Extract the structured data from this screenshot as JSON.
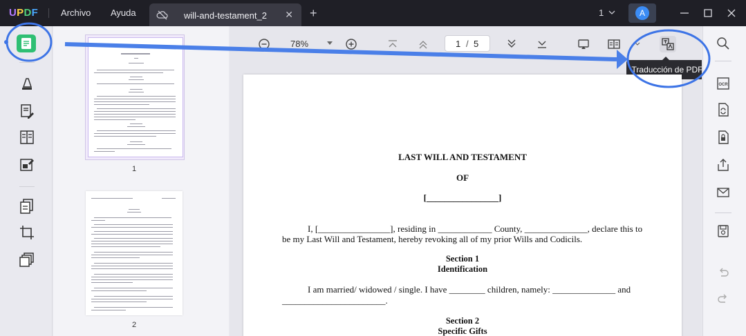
{
  "app": {
    "logo": {
      "l1": "U",
      "l2": "P",
      "l3": "D",
      "l4": "F"
    },
    "menu": {
      "file": "Archivo",
      "help": "Ayuda"
    },
    "tab": {
      "title": "will-and-testament_2",
      "close": "✕"
    },
    "new_tab": "+",
    "window_count": "1",
    "avatar_initial": "A"
  },
  "toolbar": {
    "zoom": "78%",
    "page_current": "1",
    "page_separator": "/",
    "page_total": "5",
    "tooltip": "Traducción de PDF"
  },
  "thumbnails": {
    "items": [
      {
        "label": "1"
      },
      {
        "label": "2"
      }
    ]
  },
  "document": {
    "title": "LAST WILL AND TESTAMENT",
    "of": "OF",
    "name_blank": "[________________]",
    "para1_line1": "I, [________________], residing in ____________ County, ______________, declare this to",
    "para1_line2": "be my Last Will and Testament, hereby revoking all of my prior Wills and Codicils.",
    "section1_title": "Section 1",
    "section1_sub": "Identification",
    "para2_line1": "I am married/ widowed / single.  I have ________ children, namely:  ______________ and",
    "para2_line2": "_______________________.",
    "section2_title": "Section 2",
    "section2_sub": "Specific Gifts"
  },
  "colors": {
    "accent_green": "#2fbf73",
    "annotation_blue": "#3d74e6",
    "titlebar": "#1f1f26"
  }
}
